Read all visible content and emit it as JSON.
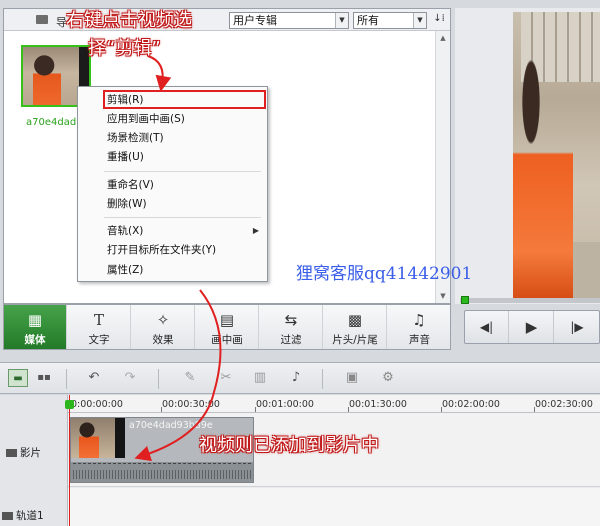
{
  "media_panel": {
    "folder_label": "导",
    "album_select": "用户专辑",
    "filter_select": "所有",
    "thumb_caption": "a70e4dad93"
  },
  "context_menu": {
    "items": [
      {
        "label": "剪辑(R)"
      },
      {
        "label": "应用到画中画(S)"
      },
      {
        "label": "场景检测(T)"
      },
      {
        "label": "重播(U)"
      },
      {
        "label": "重命名(V)"
      },
      {
        "label": "删除(W)"
      },
      {
        "label": "音轨(X)",
        "submenu": "▶"
      },
      {
        "label": "打开目标所在文件夹(Y)"
      },
      {
        "label": "属性(Z)"
      }
    ]
  },
  "tabs": [
    {
      "label": "媒体",
      "icon": "film-icon",
      "glyph": "▦"
    },
    {
      "label": "文字",
      "icon": "text-icon",
      "glyph": "T"
    },
    {
      "label": "效果",
      "icon": "magic-wand-icon",
      "glyph": "✧"
    },
    {
      "label": "画中画",
      "icon": "pip-icon",
      "glyph": "▤"
    },
    {
      "label": "过滤",
      "icon": "transition-icon",
      "glyph": "⇆"
    },
    {
      "label": "片头/片尾",
      "icon": "clapper-icon",
      "glyph": "▩"
    },
    {
      "label": "声音",
      "icon": "headphones-icon",
      "glyph": "♫"
    }
  ],
  "playback": {
    "prev": "◀|",
    "play": "▶",
    "next": "|▶"
  },
  "timeline": {
    "ruler_ticks": [
      "0:00:00:00",
      "00:00:30:00",
      "00:01:00:00",
      "00:01:30:00",
      "00:02:00:00",
      "00:02:30:00"
    ],
    "tracks": [
      {
        "label": "影片"
      },
      {
        "label": "轨道1"
      }
    ],
    "clip_name": "a70e4dad93b89e"
  },
  "annotations": {
    "step1_line1": "右键点击视频选",
    "step1_line2": "择“剪辑”",
    "step2": "视频则已添加到影片中"
  },
  "watermark": "狸窝客服qq41442901",
  "colors": {
    "accent_green": "#2ab81d",
    "highlight_red": "#e02020",
    "watermark_blue": "#3a5ee8"
  }
}
